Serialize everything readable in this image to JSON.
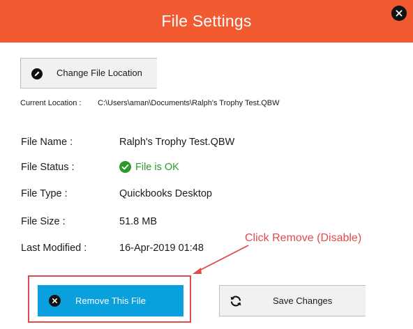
{
  "header": {
    "title": "File Settings",
    "color": "#f25a31"
  },
  "change_location_button": {
    "label": "Change File Location",
    "icon": "pencil-icon"
  },
  "current_location": {
    "label": "Current Location :",
    "value": "C:\\Users\\aman\\Documents\\Ralph's Trophy  Test.QBW"
  },
  "details": {
    "file_name_label": "File Name :",
    "file_name_value": "Ralph's Trophy  Test.QBW",
    "file_status_label": "File Status :",
    "file_status_value": "File is OK",
    "file_type_label": "File Type :",
    "file_type_value": "Quickbooks Desktop",
    "file_size_label": "File Size :",
    "file_size_value": "51.8 MB",
    "last_modified_label": "Last Modified :",
    "last_modified_value": "16-Apr-2019 01:48"
  },
  "annotation": {
    "text": "Click Remove (Disable)",
    "color": "#e24a4a"
  },
  "remove_button": {
    "label": "Remove This File",
    "icon": "close-circle-icon",
    "color": "#0aa0de"
  },
  "save_button": {
    "label": "Save Changes",
    "icon": "refresh-icon"
  },
  "colors": {
    "status_ok": "#2e9a2e"
  }
}
